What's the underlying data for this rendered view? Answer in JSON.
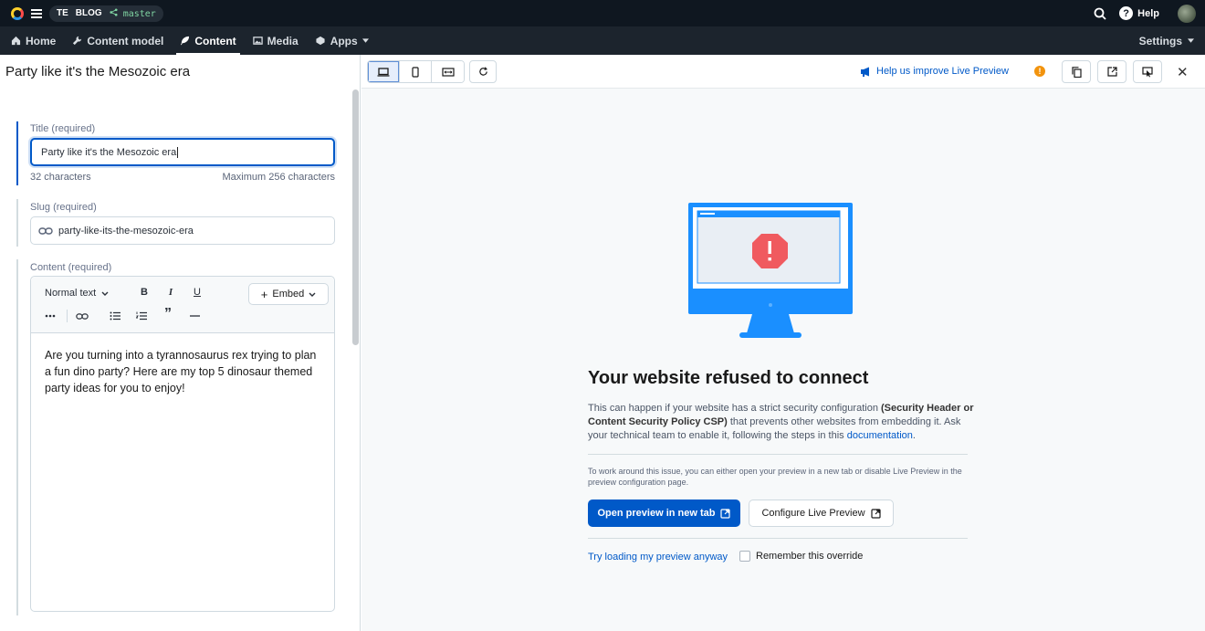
{
  "topbar": {
    "space_initials": "TE",
    "space_name": "BLOG",
    "environment": "master",
    "help_label": "Help"
  },
  "nav": {
    "items": [
      {
        "label": "Home",
        "icon": "home-icon"
      },
      {
        "label": "Content model",
        "icon": "wrench-icon"
      },
      {
        "label": "Content",
        "icon": "feather-icon"
      },
      {
        "label": "Media",
        "icon": "image-icon"
      },
      {
        "label": "Apps",
        "icon": "apps-icon"
      }
    ],
    "active": "Content",
    "settings_label": "Settings"
  },
  "editor": {
    "entry_title": "Party like it's the Mesozoic era",
    "title_field": {
      "label": "Title (required)",
      "value": "Party like it's the Mesozoic era",
      "count": "32 characters",
      "max": "Maximum 256 characters"
    },
    "slug_field": {
      "label": "Slug (required)",
      "value": "party-like-its-the-mesozoic-era"
    },
    "content_field": {
      "label": "Content (required)",
      "format_select": "Normal text",
      "embed_label": "Embed",
      "body": "Are you turning into a tyrannosaurus rex trying to plan a fun dino party? Here are my top 5 dinosaur themed party ideas for you to enjoy!"
    }
  },
  "preview": {
    "help_link": "Help us improve Live Preview",
    "warning_badge": "!",
    "error_title": "Your website refused to connect",
    "desc_part1": "This can happen if your website has a strict security configuration ",
    "desc_bold": "(Security Header or Content Security Policy CSP)",
    "desc_part2": " that prevents other websites from embedding it. Ask your technical team to enable it, following the steps in this ",
    "desc_link": "documentation",
    "desc_end": ".",
    "note": "To work around this issue, you can either open your preview in a new tab or disable Live Preview in the preview configuration page.",
    "open_button": "Open preview in new tab",
    "configure_button": "Configure Live Preview",
    "try_link": "Try loading my preview anyway",
    "remember_label": "Remember this override"
  },
  "colors": {
    "accent": "#0059c8",
    "topbar": "#0f1720",
    "navbar": "#1c242d",
    "illustration": "#1a8fff",
    "error": "#f05a5f"
  }
}
